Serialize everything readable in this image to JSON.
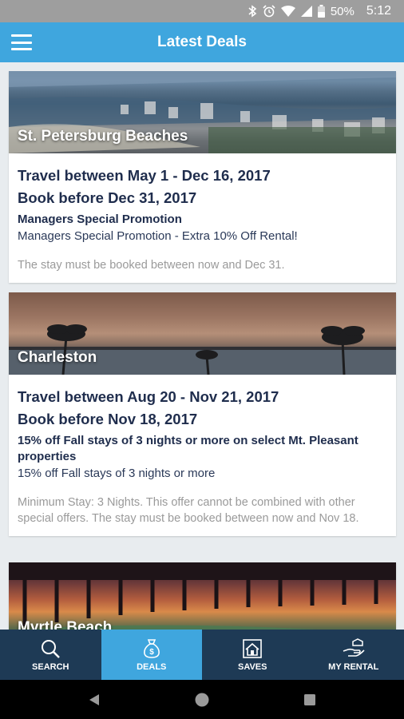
{
  "status_bar": {
    "battery": "50%",
    "time": "5:12",
    "icons": [
      "bluetooth-icon",
      "alarm-icon",
      "wifi-icon",
      "signal-icon",
      "battery-icon"
    ]
  },
  "app_bar": {
    "title": "Latest Deals",
    "color": "#3fa6de"
  },
  "deals": [
    {
      "place": "St. Petersburg Beaches",
      "travel": "Travel between May 1 - Dec 16, 2017",
      "book_before": "Book before Dec 31, 2017",
      "title": "Managers Special Promotion",
      "description": "Managers Special Promotion - Extra 10% Off Rental!",
      "terms": "The stay must be booked between now and Dec 31."
    },
    {
      "place": "Charleston",
      "travel": "Travel between Aug 20 - Nov 21, 2017",
      "book_before": "Book before Nov 18, 2017",
      "title": "15% off Fall stays of 3 nights or more on select Mt. Pleasant properties",
      "description": "15% off Fall stays of 3 nights or more",
      "terms": "Minimum Stay: 3 Nights. This offer cannot be combined with other special offers. The stay must be booked between now and Nov 18."
    },
    {
      "place": "Myrtle Beach"
    }
  ],
  "bottom_nav": {
    "items": [
      {
        "label": "SEARCH",
        "icon": "search-icon"
      },
      {
        "label": "DEALS",
        "icon": "money-bag-icon",
        "active": true
      },
      {
        "label": "SAVES",
        "icon": "house-saves-icon"
      },
      {
        "label": "MY RENTAL",
        "icon": "hand-rental-icon"
      }
    ],
    "background": "#1e3a55",
    "active_color": "#3fa6de"
  },
  "system_nav": {
    "buttons": [
      "back-icon",
      "home-icon",
      "recents-icon"
    ]
  }
}
